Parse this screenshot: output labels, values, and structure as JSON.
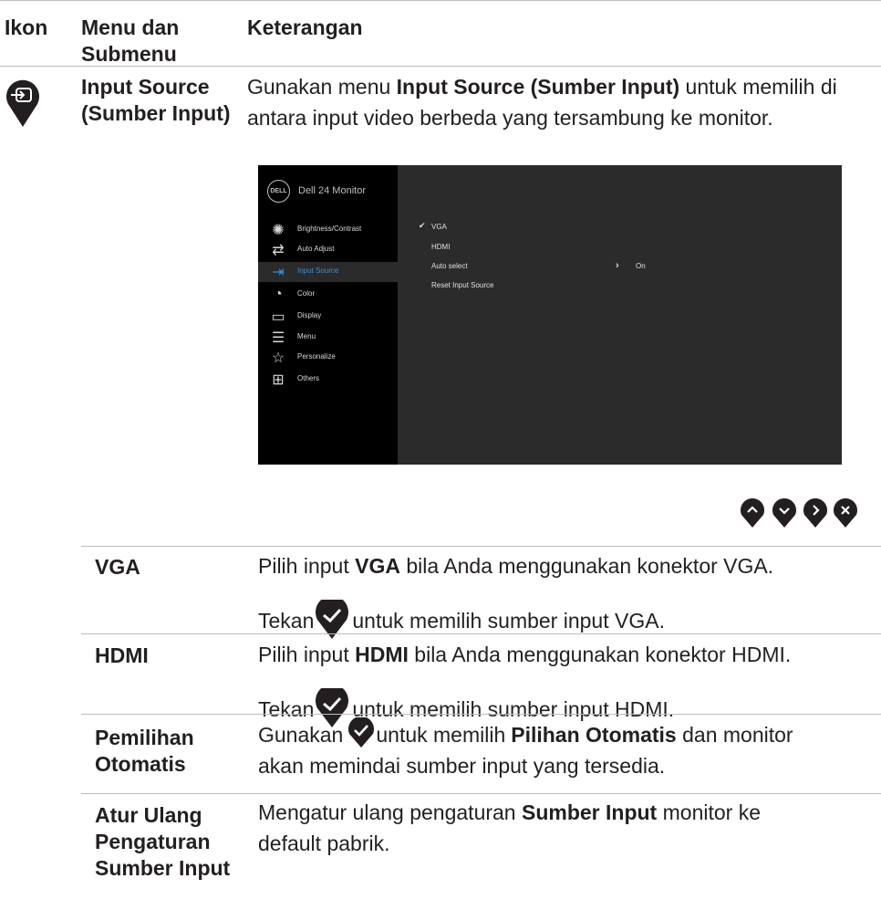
{
  "headers": {
    "icon": "Ikon",
    "menu": "Menu dan Submenu",
    "desc": "Keterangan"
  },
  "main": {
    "icon": "input-source-icon",
    "name": "Input Source (Sumber Input)",
    "desc_pre": "Gunakan menu ",
    "desc_bold": "Input Source (Sumber Input)",
    "desc_post": " untuk memilih di antara input video berbeda yang tersambung ke monitor."
  },
  "osd": {
    "logo": "DELL",
    "title": "Dell 24 Monitor",
    "menu": [
      {
        "label": "Brightness/Contrast",
        "icon": "sun-icon"
      },
      {
        "label": "Auto Adjust",
        "icon": "auto-adjust-icon"
      },
      {
        "label": "Input Source",
        "icon": "input-source-icon"
      },
      {
        "label": "Color",
        "icon": "palette-icon"
      },
      {
        "label": "Display",
        "icon": "monitor-icon"
      },
      {
        "label": "Menu",
        "icon": "menu-icon"
      },
      {
        "label": "Personalize",
        "icon": "star-icon"
      },
      {
        "label": "Others",
        "icon": "others-icon"
      }
    ],
    "options": [
      "VGA",
      "HDMI",
      "Auto select",
      "Reset Input Source"
    ],
    "auto_value": "On"
  },
  "nav_buttons": [
    "up-button",
    "down-button",
    "right-button",
    "close-button"
  ],
  "rows": [
    {
      "name": "VGA",
      "l1_pre": "Pilih input ",
      "l1_bold": "VGA",
      "l1_post": " bila Anda menggunakan konektor VGA.",
      "l2_pre": "Tekan ",
      "l2_post": " untuk memilih sumber input VGA."
    },
    {
      "name": "HDMI",
      "l1_pre": "Pilih input ",
      "l1_bold": "HDMI",
      "l1_post": " bila Anda menggunakan konektor HDMI.",
      "l2_pre": "Tekan ",
      "l2_post": " untuk memilih sumber input HDMI."
    },
    {
      "name": "Pemilihan Otomatis",
      "l1_pre": "Gunakan ",
      "l1_mid": " untuk memilih ",
      "l1_bold": "Pilihan Otomatis",
      "l1_post": " dan monitor",
      "l2": "akan memindai sumber input yang tersedia."
    },
    {
      "name": "Atur Ulang Pengaturan Sumber Input",
      "l1_pre": "Mengatur ulang pengaturan ",
      "l1_bold": "Sumber Input",
      "l1_post": " monitor ke",
      "l2": "default pabrik."
    }
  ]
}
